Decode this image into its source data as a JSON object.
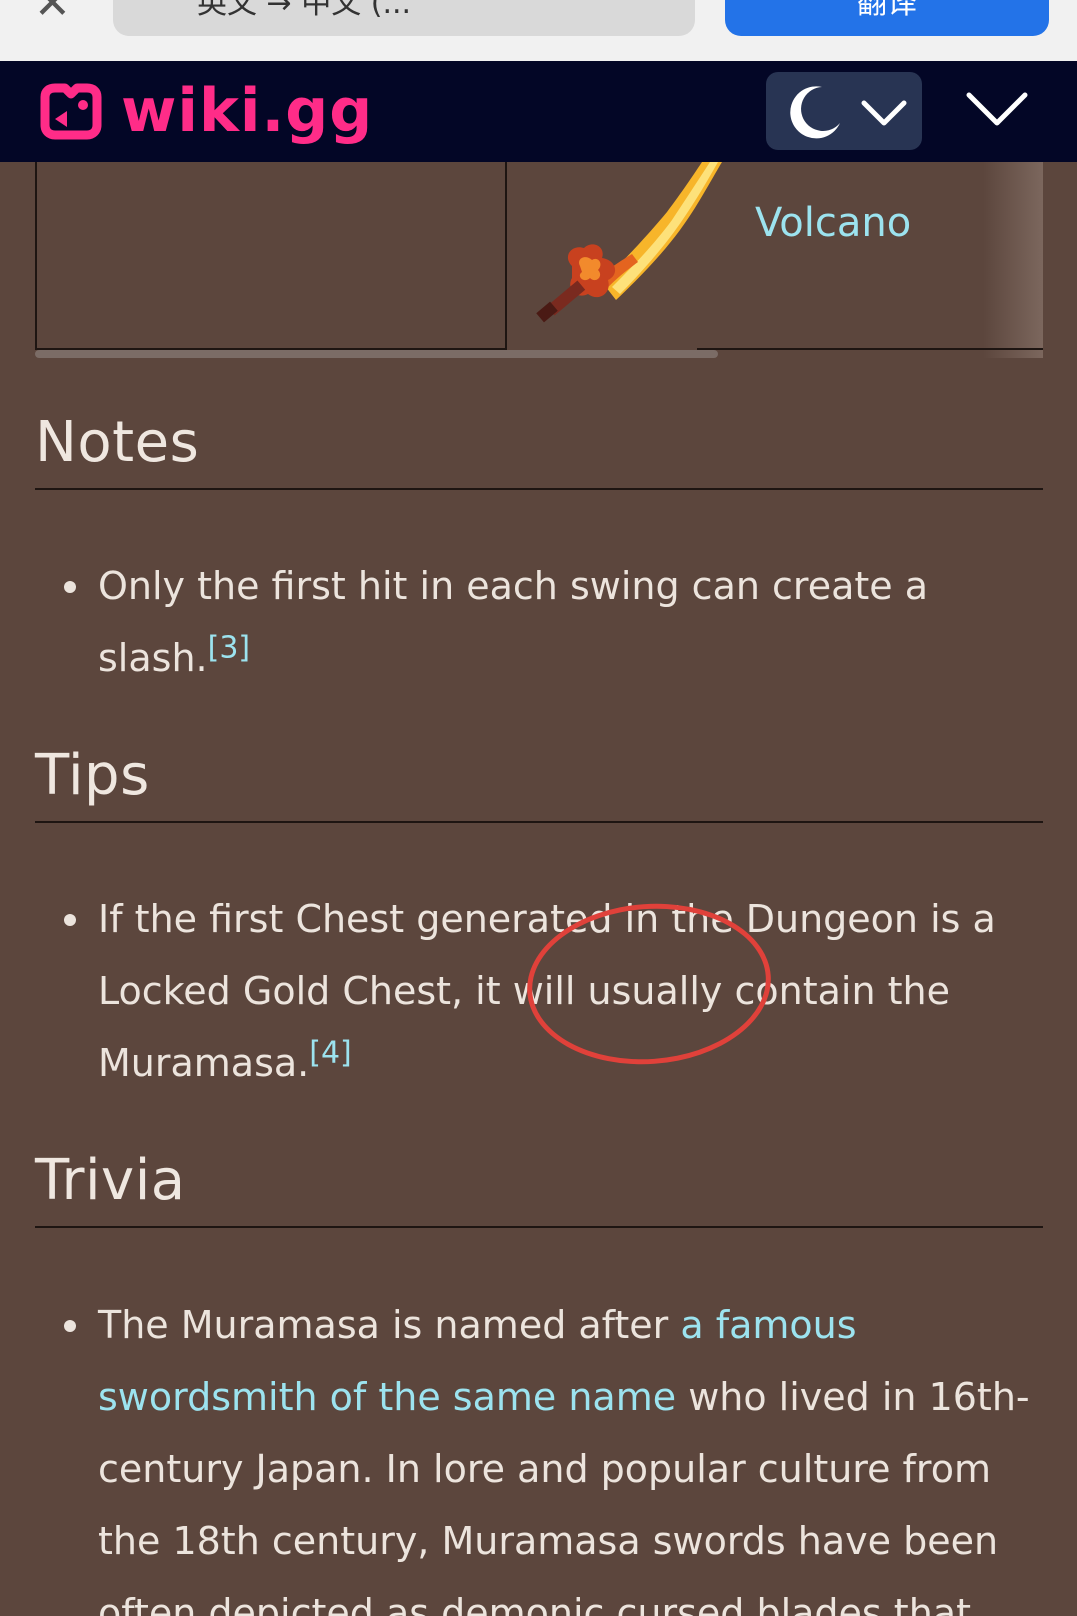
{
  "translate_bar": {
    "close_icon": "close-icon",
    "language_label": "英文 → 中文 (...",
    "translate_button": "翻译"
  },
  "header": {
    "logo_text": "wiki.gg",
    "theme_toggle_icon": "moon-icon",
    "menu_icon": "chevron-down-icon"
  },
  "table": {
    "cell_link": "Volcano",
    "image": "muramasa-sword-sprite"
  },
  "sections": {
    "notes": {
      "title": "Notes",
      "items": [
        {
          "text": "Only the first hit in each swing can create a slash.",
          "ref": "[3]"
        }
      ]
    },
    "tips": {
      "title": "Tips",
      "items": [
        {
          "text": "If the first Chest generated in the Dungeon is a Locked Gold Chest, it will usually contain the Muramasa.",
          "ref": "[4]"
        }
      ]
    },
    "trivia": {
      "title": "Trivia",
      "items": [
        {
          "text_before": "The Muramasa is named after ",
          "link": "a famous swordsmith of the same name",
          "text_after": " who lived in 16th-century Japan. In lore and popular culture from the 18th century, Muramasa swords have been often depicted as demonic cursed blades that"
        }
      ]
    }
  },
  "colors": {
    "page_background": "#5c463d",
    "header_background": "#030626",
    "logo": "#ff2c88",
    "link": "#9ce3ef",
    "annotation_circle": "#e0413a"
  }
}
